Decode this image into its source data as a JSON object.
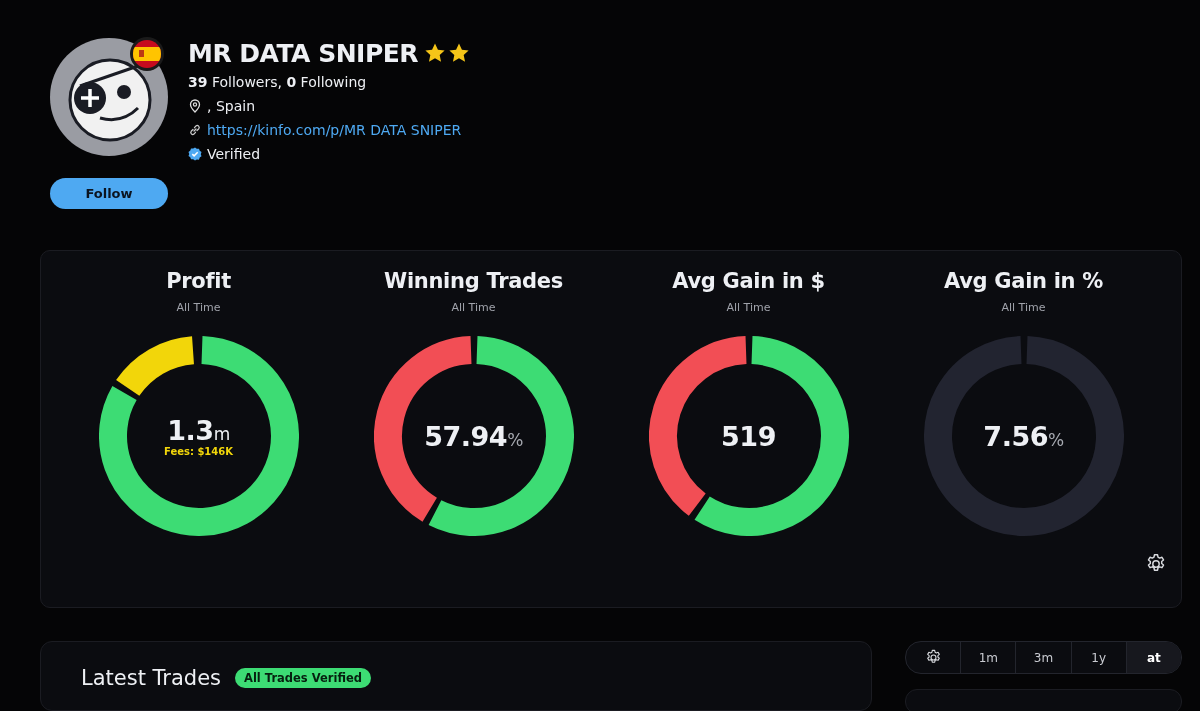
{
  "profile": {
    "name": "MR DATA SNIPER",
    "badges": [
      {
        "kind": "star"
      },
      {
        "kind": "star"
      }
    ],
    "followers_count": "39",
    "followers_label": " Followers, ",
    "following_count": "0",
    "following_label": " Following",
    "location": ", Spain",
    "link": "https://kinfo.com/p/MR DATA SNIPER",
    "verified": "Verified",
    "follow_button": "Follow"
  },
  "stats": [
    {
      "kind": "profit",
      "title": "Profit",
      "period": "All Time",
      "value": "1.3",
      "unit": "m",
      "note": "Fees: $146K"
    },
    {
      "kind": "winrate",
      "title": "Winning Trades",
      "period": "All Time",
      "value": "57.94",
      "unit": "%"
    },
    {
      "kind": "gain_usd",
      "title": "Avg Gain in $",
      "period": "All Time",
      "value": "519"
    },
    {
      "kind": "gain_pct",
      "title": "Avg Gain in %",
      "period": "All Time",
      "value": "7.56",
      "unit": "%"
    }
  ],
  "latest_trades": {
    "title": "Latest Trades",
    "badge": "All Trades Verified"
  },
  "ranges": [
    {
      "label": "1m",
      "selected": false
    },
    {
      "label": "3m",
      "selected": false
    },
    {
      "label": "1y",
      "selected": false
    },
    {
      "label": "at",
      "selected": true
    }
  ]
}
